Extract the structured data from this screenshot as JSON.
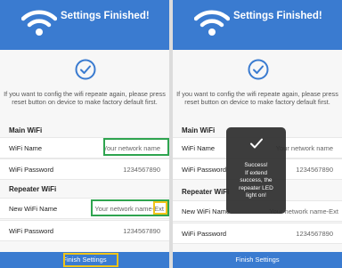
{
  "header": {
    "title": "Settings Finished!"
  },
  "note": "If you want to config the wifi repeate again, please press reset button on device to make factory default first.",
  "main": {
    "section": "Main WiFi",
    "name_label": "WiFi Name",
    "name_value": "Your network name",
    "password_label": "WiFi Password",
    "password_value": "1234567890"
  },
  "repeater": {
    "section": "Repeater WiFi",
    "name_label": "New WiFi Name",
    "name_value_left": "Your network name-",
    "name_suffix": "Ext",
    "name_value_right": "Your network name-Ext",
    "password_label": "WiFi Password",
    "password_value": "1234567890"
  },
  "footer": {
    "finish_label": "Finish Settings"
  },
  "toast": {
    "line1": "Success!",
    "line2": "If extend",
    "line3": "success, the",
    "line4": "repeater LED",
    "line5": "light on!"
  },
  "colors": {
    "header": "#3a7bd0",
    "check": "#3a7bd0",
    "highlight_green": "#2ea44f",
    "highlight_yellow": "#f0c419"
  },
  "icons": [
    "wifi-icon",
    "checkmark-icon"
  ]
}
